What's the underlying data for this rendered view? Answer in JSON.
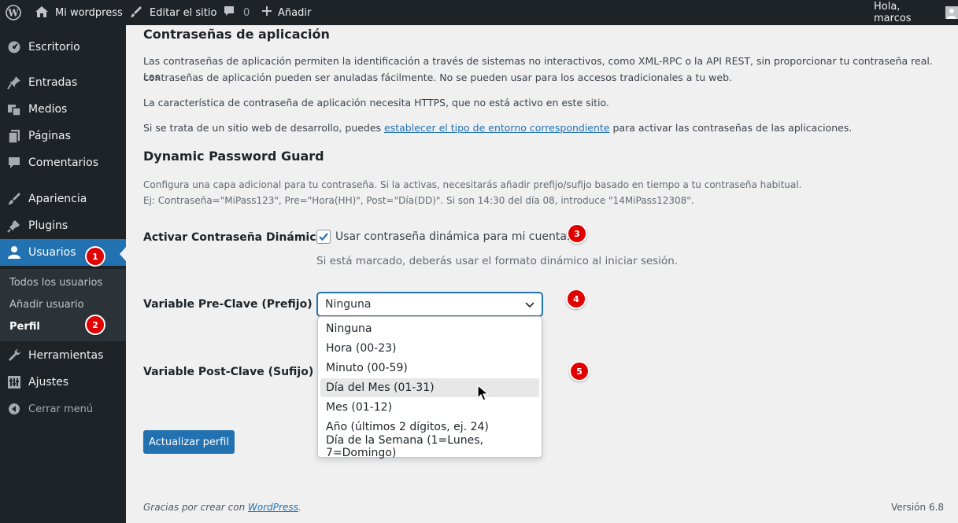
{
  "adminbar": {
    "site_name": "Mi wordpress",
    "edit_site": "Editar el sitio",
    "comments_count": "0",
    "add_new": "Añadir",
    "greeting": "Hola, marcos"
  },
  "sidebar": {
    "items": [
      {
        "label": "Escritorio",
        "icon": "dashboard-icon"
      },
      {
        "label": "Entradas",
        "icon": "pin-icon"
      },
      {
        "label": "Medios",
        "icon": "media-icon"
      },
      {
        "label": "Páginas",
        "icon": "page-icon"
      },
      {
        "label": "Comentarios",
        "icon": "comment-icon"
      },
      {
        "label": "Apariencia",
        "icon": "brush-icon"
      },
      {
        "label": "Plugins",
        "icon": "plugin-icon"
      },
      {
        "label": "Usuarios",
        "icon": "user-icon"
      },
      {
        "label": "Herramientas",
        "icon": "wrench-icon"
      },
      {
        "label": "Ajustes",
        "icon": "settings-icon"
      },
      {
        "label": "Cerrar menú",
        "icon": "collapse-icon"
      }
    ],
    "submenu": [
      "Todos los usuarios",
      "Añadir usuario",
      "Perfil"
    ]
  },
  "badges": [
    "1",
    "2",
    "3",
    "4",
    "5"
  ],
  "app_passwords": {
    "title": "Contraseñas de aplicación",
    "p1_line1": "Las contraseñas de aplicación permiten la identificación a través de sistemas no interactivos, como XML-RPC o la API REST, sin proporcionar tu contraseña real. Las",
    "p1_line2": "contraseñas de aplicación pueden ser anuladas fácilmente. No se pueden usar para los accesos tradicionales a tu web.",
    "p2": "La característica de contraseña de aplicación necesita HTTPS, que no está activo en este sitio.",
    "p3_before": "Si se trata de un sitio web de desarrollo, puedes ",
    "p3_link": "establecer el tipo de entorno correspondiente",
    "p3_after": " para activar las contraseñas de las aplicaciones."
  },
  "dpg": {
    "title": "Dynamic Password Guard",
    "desc_line1": "Configura una capa adicional para tu contraseña. Si la activas, necesitarás añadir prefijo/sufijo basado en tiempo a tu contraseña habitual.",
    "desc_line2": "Ej: Contraseña=\"MiPass123\", Pre=\"Hora(HH)\", Post=\"Día(DD)\". Si son 14:30 del día 08, introduce \"14MiPass12308\".",
    "activate_label": "Activar Contraseña Dinámica",
    "checkbox_label": "Usar contraseña dinámica para mi cuenta.",
    "checkbox_checked": true,
    "checkbox_desc": "Si está marcado, deberás usar el formato dinámico al iniciar sesión.",
    "prefix_label": "Variable Pre-Clave (Prefijo)",
    "prefix_value": "Ninguna",
    "suffix_label": "Variable Post-Clave (Sufijo)",
    "options": [
      "Ninguna",
      "Hora (00-23)",
      "Minuto (00-59)",
      "Día del Mes (01-31)",
      "Mes (01-12)",
      "Año (últimos 2 dígitos, ej. 24)",
      "Día de la Semana (1=Lunes, 7=Domingo)"
    ],
    "hovered_option": "Día del Mes (01-31)"
  },
  "update_button": "Actualizar perfil",
  "footer": {
    "thanks_before": "Gracias por crear con ",
    "thanks_link": "WordPress",
    "thanks_after": ".",
    "version": "Versión 6.8"
  },
  "colors": {
    "admin_dark": "#1d2327",
    "accent": "#2271b1",
    "badge_red": "#e00000"
  }
}
